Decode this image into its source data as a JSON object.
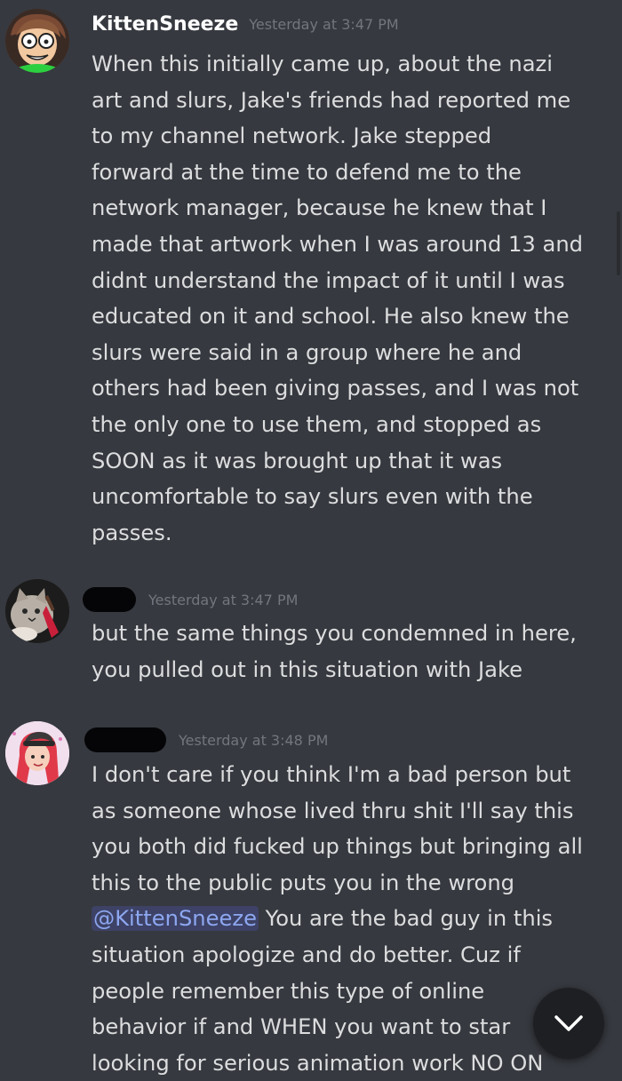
{
  "colors": {
    "background": "#36393f",
    "username": "#ffffff",
    "timestamp": "#72767d",
    "text": "#dcddde",
    "mention": "#8da7f0"
  },
  "messages": [
    {
      "username": "KittenSneeze",
      "timestamp": "Yesterday at 3:47 PM",
      "avatar_icon": "cartoon-character-avatar-icon",
      "lines": [
        "When this initially came up, about the nazi",
        "art and slurs, Jake's friends had reported me",
        "to my channel network. Jake stepped",
        "forward at the time to defend me to the",
        "network manager, because he knew that I",
        "made that artwork when I was around 13 and",
        "didnt understand the impact of it until I was",
        "educated on it and school. He also knew the",
        "slurs were said in a group where he and",
        "others had been giving passes, and I was not",
        "the only one to use them, and stopped as",
        "SOON as it was brought up that it was",
        "uncomfortable to say slurs even with the",
        "passes."
      ]
    },
    {
      "username": "",
      "timestamp": "Yesterday at 3:47 PM",
      "avatar_icon": "cat-with-guitar-avatar-icon",
      "lines": [
        "but the same things you condemned in here,",
        "you pulled out in this situation with Jake"
      ]
    },
    {
      "username": "",
      "timestamp": "Yesterday at 3:48 PM",
      "avatar_icon": "red-haired-girl-avatar-icon",
      "lines": [
        "I don't care if you think I'm a bad person but",
        "as someone whose lived thru shit I'll say this",
        "you both did fucked up things but bringing all",
        "this to the public puts you in the wrong"
      ],
      "mention": "@KittenSneeze",
      "mention_line_rest": " You are the bad guy in this",
      "lines_after": [
        "situation apologize and do better. Cuz if",
        "people remember this type of online",
        "behavior if and WHEN you want to star",
        "looking for serious animation work NO ON"
      ]
    }
  ],
  "jump_button": {
    "icon": "chevron-down-icon"
  }
}
